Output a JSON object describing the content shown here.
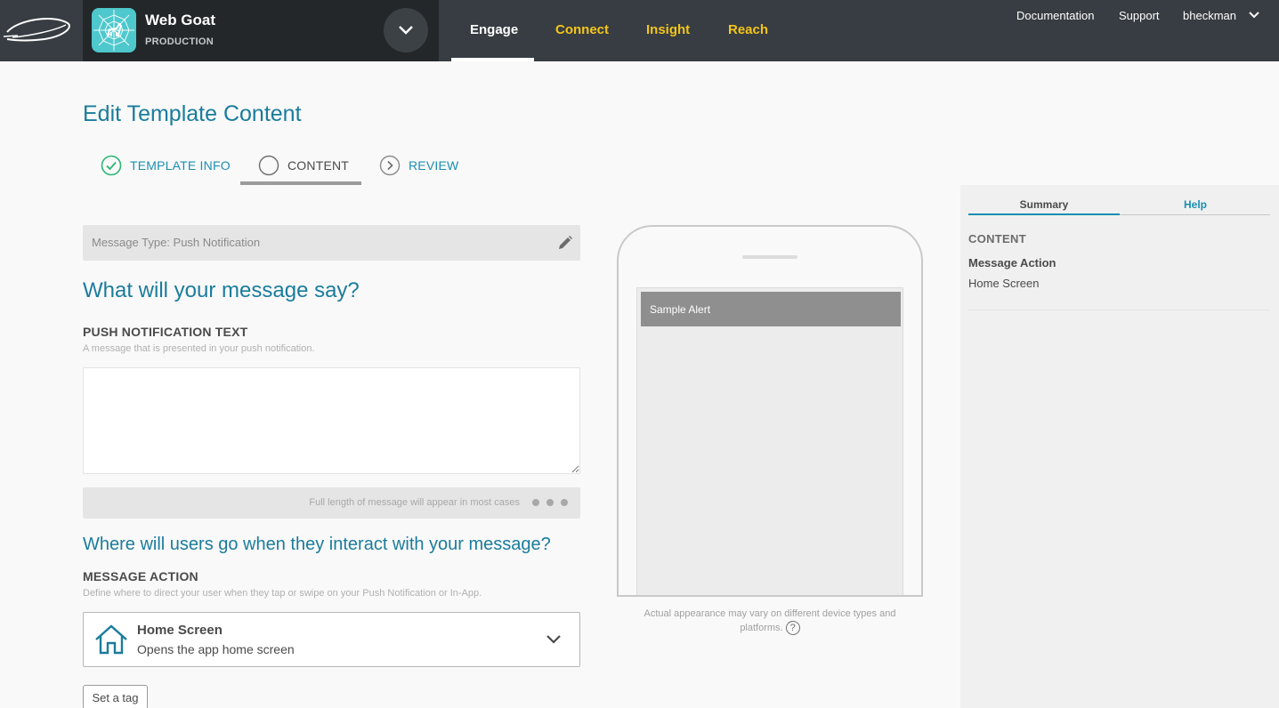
{
  "app": {
    "name": "Web Goat",
    "environment": "PRODUCTION"
  },
  "nav": {
    "tabs": [
      {
        "label": "Engage",
        "active": true
      },
      {
        "label": "Connect"
      },
      {
        "label": "Insight"
      },
      {
        "label": "Reach"
      }
    ],
    "links": {
      "documentation": "Documentation",
      "support": "Support",
      "user": "bheckman"
    }
  },
  "page": {
    "title": "Edit Template Content"
  },
  "steps": [
    {
      "label": "TEMPLATE INFO",
      "state": "complete"
    },
    {
      "label": "CONTENT",
      "state": "current"
    },
    {
      "label": "REVIEW",
      "state": "next"
    }
  ],
  "form": {
    "message_type": "Message Type: Push Notification",
    "heading_say": "What will your message say?",
    "push_label": "PUSH NOTIFICATION TEXT",
    "push_help": "A message that is presented in your push notification.",
    "push_value": "",
    "length_note": "Full length of message will appear in most cases",
    "heading_where": "Where will users go when they interact with your message?",
    "action_label": "MESSAGE ACTION",
    "action_help": "Define where to direct your user when they tap or swipe on your Push Notification or In-App.",
    "action_selected_title": "Home Screen",
    "action_selected_sub": "Opens the app home screen",
    "tag_button": "Set a tag"
  },
  "preview": {
    "alert_text": "Sample Alert",
    "note": "Actual appearance may vary on different device types and platforms.",
    "help_glyph": "?"
  },
  "side_panel": {
    "tabs": [
      {
        "label": "Summary",
        "active": true
      },
      {
        "label": "Help"
      }
    ],
    "section": "CONTENT",
    "key": "Message Action",
    "value": "Home Screen"
  },
  "colors": {
    "topbar": "#373d42",
    "accent": "#1a8fb0",
    "nav_yellow": "#f5c518",
    "app_icon": "#4ec8cc"
  }
}
